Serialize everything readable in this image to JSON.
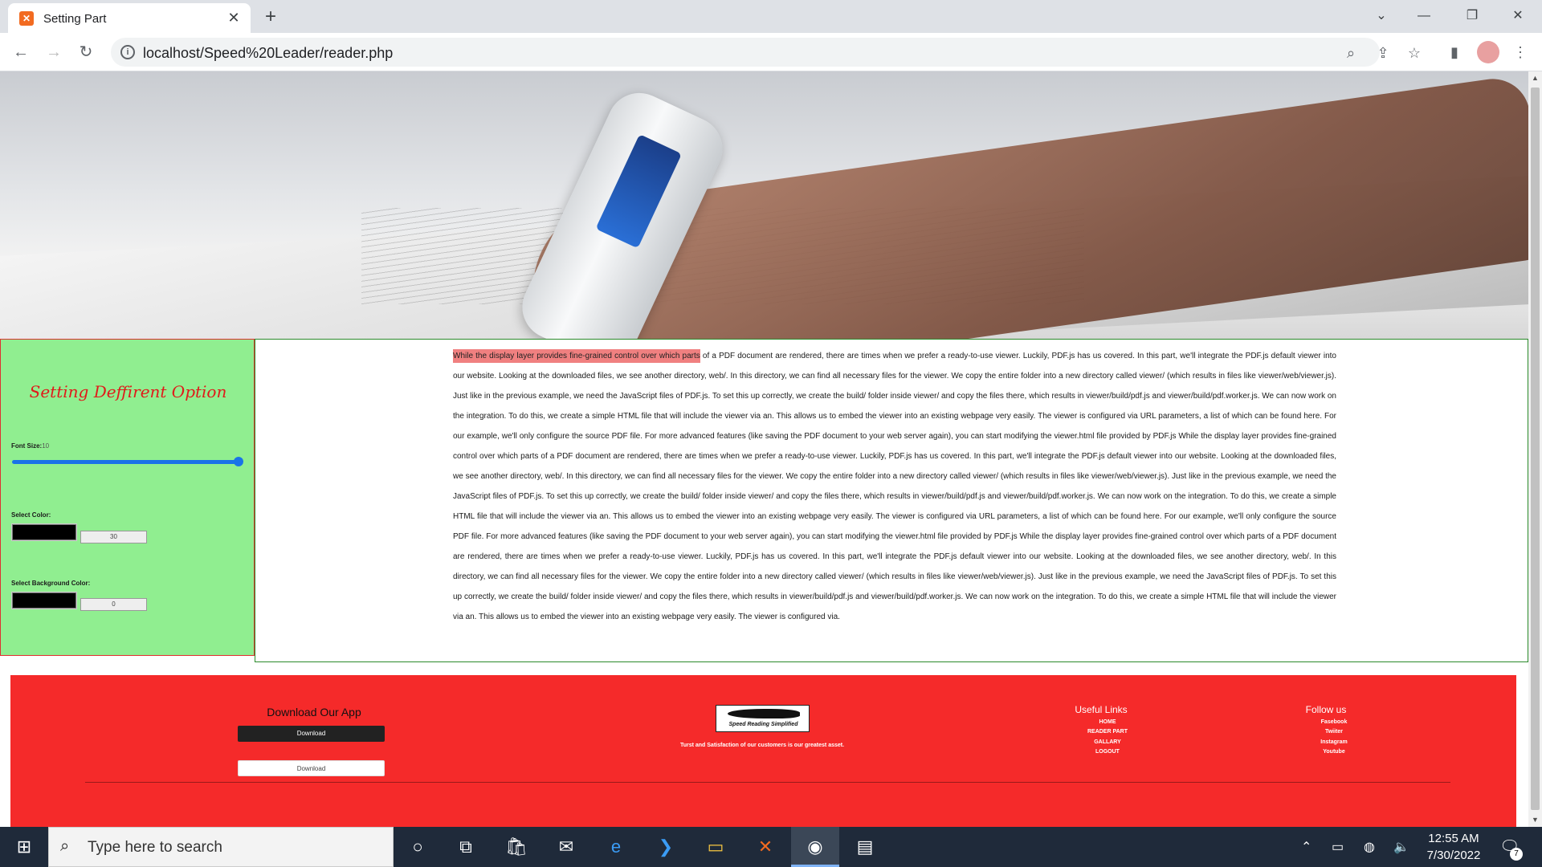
{
  "browser": {
    "tab_title": "Setting Part",
    "tab_favicon": "xampp-icon",
    "url": "localhost/Speed%20Leader/reader.php",
    "new_tab": "+",
    "close_tab": "✕"
  },
  "settings": {
    "title": "Setting Deffirent Option",
    "font_size_label": "Font Size:",
    "font_size_value": "10",
    "select_color_label": "Select Color:",
    "color_value": "30",
    "select_bg_label": "Select Background Color:",
    "bg_value": "0",
    "accent_color": "#90ee90"
  },
  "reader": {
    "highlighted": "While the display layer provides fine-grained control over which parts",
    "text": " of a PDF document are rendered, there are times when we prefer a ready-to-use viewer. Luckily, PDF.js has us covered. In this part, we'll integrate the PDF.js default viewer into our website. Looking at the downloaded files, we see another directory, web/. In this directory, we can find all necessary files for the viewer. We copy the entire folder into a new directory called viewer/ (which results in files like viewer/web/viewer.js). Just like in the previous example, we need the JavaScript files of PDF.js. To set this up correctly, we create the build/ folder inside viewer/ and copy the files there, which results in viewer/build/pdf.js and viewer/build/pdf.worker.js. We can now work on the integration. To do this, we create a simple HTML file that will include the viewer via an. This allows us to embed the viewer into an existing webpage very easily. The viewer is configured via URL parameters, a list of which can be found here. For our example, we'll only configure the source PDF file. For more advanced features (like saving the PDF document to your web server again), you can start modifying the viewer.html file provided by PDF.js While the display layer provides fine-grained control over which parts of a PDF document are rendered, there are times when we prefer a ready-to-use viewer. Luckily, PDF.js has us covered. In this part, we'll integrate the PDF.js default viewer into our website. Looking at the downloaded files, we see another directory, web/. In this directory, we can find all necessary files for the viewer. We copy the entire folder into a new directory called viewer/ (which results in files like viewer/web/viewer.js). Just like in the previous example, we need the JavaScript files of PDF.js. To set this up correctly, we create the build/ folder inside viewer/ and copy the files there, which results in viewer/build/pdf.js and viewer/build/pdf.worker.js. We can now work on the integration. To do this, we create a simple HTML file that will include the viewer via an. This allows us to embed the viewer into an existing webpage very easily. The viewer is configured via URL parameters, a list of which can be found here. For our example, we'll only configure the source PDF file. For more advanced features (like saving the PDF document to your web server again), you can start modifying the viewer.html file provided by PDF.js While the display layer provides fine-grained control over which parts of a PDF document are rendered, there are times when we prefer a ready-to-use viewer. Luckily, PDF.js has us covered. In this part, we'll integrate the PDF.js default viewer into our website. Looking at the downloaded files, we see another directory, web/. In this directory, we can find all necessary files for the viewer. We copy the entire folder into a new directory called viewer/ (which results in files like viewer/web/viewer.js). Just like in the previous example, we need the JavaScript files of PDF.js. To set this up correctly, we create the build/ folder inside viewer/ and copy the files there, which results in viewer/build/pdf.js and viewer/build/pdf.worker.js. We can now work on the integration. To do this, we create a simple HTML file that will include the viewer via an. This allows us to embed the viewer into an existing webpage very easily. The viewer is configured via.",
    "highlight_color": "#f08080"
  },
  "footer": {
    "download_heading": "Download Our App",
    "download_btn_1": "Download",
    "download_btn_2": "Download",
    "logo_text": "Speed Reading Simplified",
    "tagline": "Turst and Satisfaction of our customers is our greatest asset.",
    "useful_links_heading": "Useful Links",
    "useful_links": [
      "HOME",
      "READER PART",
      "GALLARY",
      "LOGOUT"
    ],
    "follow_heading": "Follow us",
    "follow_links": [
      "Fasebook",
      "Twiiter",
      "Instagram",
      "Youtube"
    ],
    "bg_color": "#f52a2a"
  },
  "taskbar": {
    "search_placeholder": "Type here to search",
    "time": "12:55 AM",
    "date": "7/30/2022",
    "notification_count": "7"
  }
}
